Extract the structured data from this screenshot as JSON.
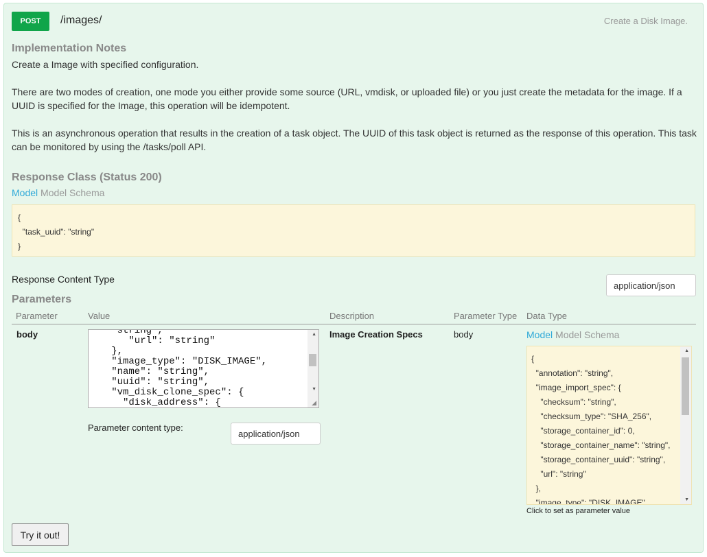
{
  "header": {
    "method": "POST",
    "path": "/images/",
    "summary": "Create a Disk Image."
  },
  "implementation_notes": {
    "title": "Implementation Notes",
    "line1": "Create a Image with specified configuration.",
    "line2": "There are two modes of creation, one mode you either provide some source (URL, vmdisk, or uploaded file) or you just create the metadata for the image. If a UUID is specified for the Image, this operation will be idempotent.",
    "line3": "This is an asynchronous operation that results in the creation of a task object. The UUID of this task object is returned as the response of this operation. This task can be monitored by using the /tasks/poll API."
  },
  "response_class": {
    "title": "Response Class (Status 200)",
    "tab_model": "Model",
    "tab_schema": "Model Schema",
    "schema_text": "{\n  \"task_uuid\": \"string\"\n}"
  },
  "response_content_type": {
    "label": "Response Content Type",
    "value": "application/json"
  },
  "parameters": {
    "title": "Parameters",
    "columns": [
      "Parameter",
      "Value",
      "Description",
      "Parameter Type",
      "Data Type"
    ],
    "row": {
      "name": "body",
      "value_text": "    string ,\n      \"url\": \"string\"\n   },\n   \"image_type\": \"DISK_IMAGE\",\n   \"name\": \"string\",\n   \"uuid\": \"string\",\n   \"vm_disk_clone_spec\": {\n     \"disk_address\": {\n       \"device_bus\": \"SCSI\",",
      "content_type_label": "Parameter content type:",
      "content_type_value": "application/json",
      "description": "Image Creation Specs",
      "param_type": "body",
      "tab_model": "Model",
      "tab_schema": "Model Schema",
      "schema_text": "{\n  \"annotation\": \"string\",\n  \"image_import_spec\": {\n    \"checksum\": \"string\",\n    \"checksum_type\": \"SHA_256\",\n    \"storage_container_id\": 0,\n    \"storage_container_name\": \"string\",\n    \"storage_container_uuid\": \"string\",\n    \"url\": \"string\"\n  },\n  \"image_type\": \"DISK_IMAGE\",",
      "hint": "Click to set as parameter value"
    }
  },
  "try_button": "Try it out!"
}
